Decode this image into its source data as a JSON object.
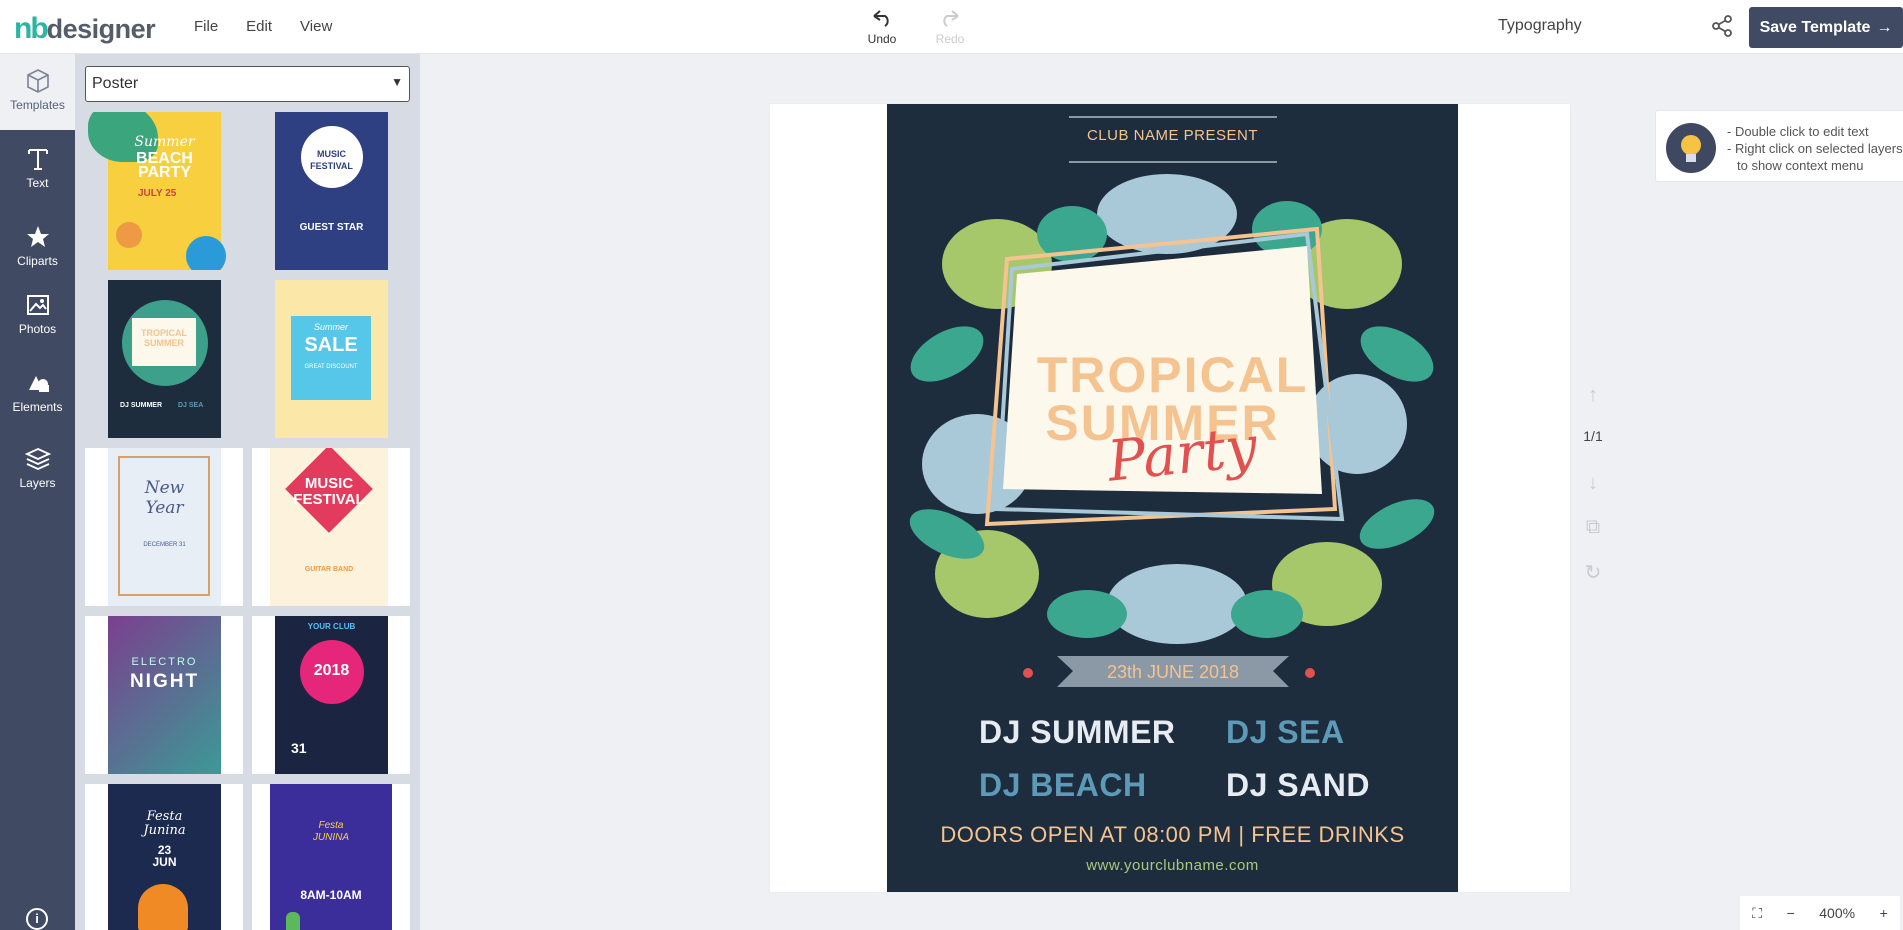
{
  "app": {
    "logo_nb": "nb",
    "logo_designer": "designer",
    "menu": [
      "File",
      "Edit",
      "View"
    ],
    "undo_label": "Undo",
    "redo_label": "Redo",
    "typography_label": "Typography",
    "save_label": "Save Template",
    "accent": "#404a63",
    "brand": "#2bb5a3"
  },
  "sidebar": {
    "items": [
      {
        "label": "Templates",
        "icon": "cube-icon"
      },
      {
        "label": "Text",
        "icon": "text-icon"
      },
      {
        "label": "Cliparts",
        "icon": "star-icon"
      },
      {
        "label": "Photos",
        "icon": "image-icon"
      },
      {
        "label": "Elements",
        "icon": "shapes-icon"
      },
      {
        "label": "Layers",
        "icon": "layers-icon"
      }
    ],
    "info_icon": "i"
  },
  "panel": {
    "category": "Poster",
    "templates": [
      {
        "name": "summer-beach-party",
        "lines": [
          "Summer",
          "BEACH",
          "PARTY",
          "JULY 25"
        ]
      },
      {
        "name": "music-festival",
        "lines": [
          "MUSIC",
          "FESTIVAL",
          "GUEST STAR"
        ]
      },
      {
        "name": "tropical-summer",
        "lines": [
          "TROPICAL",
          "SUMMER",
          "DJ SUMMER",
          "DJ SEA"
        ]
      },
      {
        "name": "summer-sale",
        "lines": [
          "Summer",
          "SALE",
          "GREAT DISCOUNT"
        ]
      },
      {
        "name": "new-year",
        "lines": [
          "New",
          "Year",
          "DECEMBER 31"
        ]
      },
      {
        "name": "music-festival-2",
        "lines": [
          "MUSIC",
          "FESTIVAL",
          "GUITAR BAND"
        ]
      },
      {
        "name": "electro-night",
        "lines": [
          "ELECTRO",
          "NIGHT"
        ]
      },
      {
        "name": "club-2018",
        "lines": [
          "YOUR CLUB",
          "2018",
          "31"
        ]
      },
      {
        "name": "festa-junina",
        "lines": [
          "Festa",
          "Junina",
          "23",
          "JUN"
        ]
      },
      {
        "name": "festa-junina-2",
        "lines": [
          "Festa",
          "JUNINA",
          "8AM-10AM"
        ]
      }
    ]
  },
  "poster": {
    "club": "CLUB NAME PRESENT",
    "title_1": "TROPICAL",
    "title_2": "SUMMER",
    "title_3": "Party",
    "date": "23th JUNE 2018",
    "dj_1": "DJ SUMMER",
    "dj_2": "DJ SEA",
    "dj_3": "DJ BEACH",
    "dj_4": "DJ SAND",
    "doors": "DOORS OPEN AT 08:00 PM | FREE DRINKS",
    "web": "www.yourclubname.com",
    "colors": {
      "bg": "#1e2d3e",
      "peach": "#f5c38f",
      "teal": "#5d9ab8",
      "cream": "#fdf8ec",
      "red": "#e0514f"
    }
  },
  "tools": {
    "page_indicator": "1/1"
  },
  "tip": {
    "line_1": "- Double click to edit text",
    "line_2": "- Right click on selected layers",
    "line_3": "to show context menu"
  },
  "zoom": {
    "level": "400%"
  }
}
